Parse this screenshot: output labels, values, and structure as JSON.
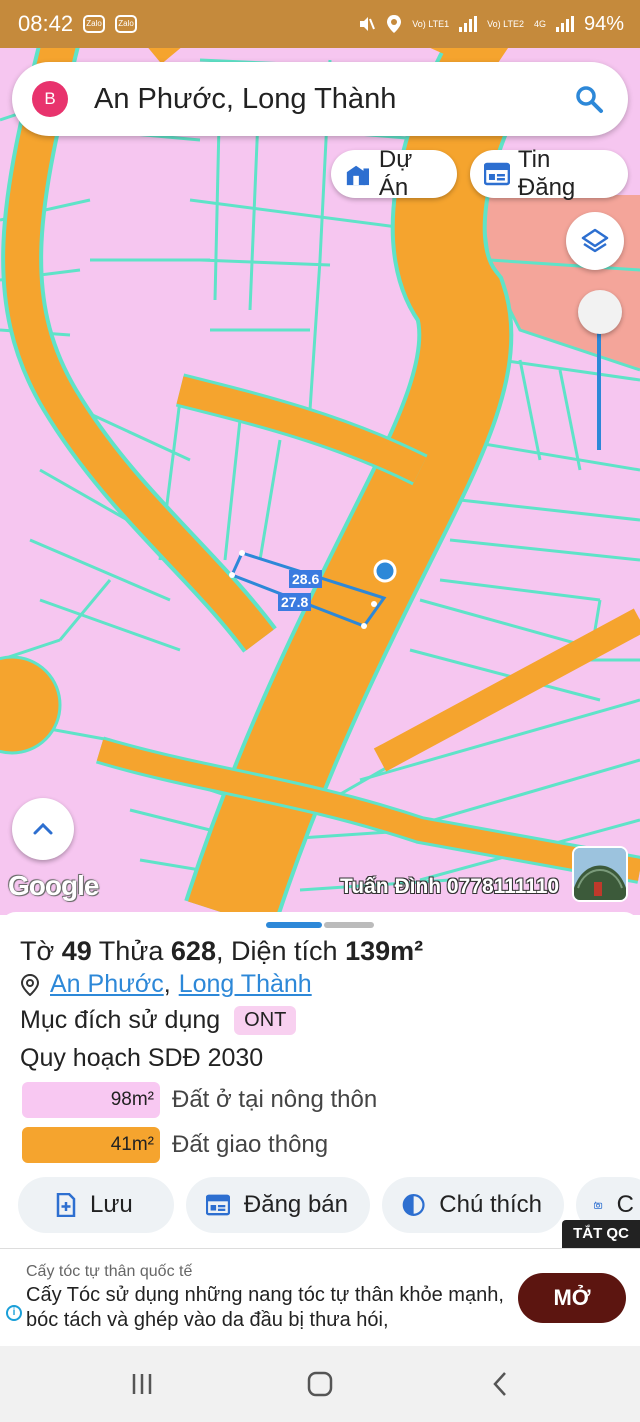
{
  "status_bar": {
    "time": "08:42",
    "app_icons": [
      "Zalo",
      "Zalo"
    ],
    "sim1": "Vo) LTE1",
    "sim2": "Vo) LTE2",
    "network": "4G",
    "battery": "94%"
  },
  "search": {
    "logo_letter": "B",
    "query": "An Phước, Long Thành"
  },
  "map_buttons": {
    "projects": "Dự Án",
    "listings": "Tin Đăng"
  },
  "map": {
    "dimension_top": "28.6",
    "dimension_bottom": "27.8",
    "google_logo": "Google",
    "watermark": "Tuấn Đình 0778111110",
    "colors": {
      "residential": "#f6c6f0",
      "road": "#f5a42e",
      "parcel_border": "#5fe3c8",
      "selection": "#2d88d8"
    }
  },
  "parcel": {
    "sheet_label": "Tờ",
    "sheet_no": "49",
    "plot_label": "Thửa",
    "plot_no": "628",
    "area_label": "Diện tích",
    "area": "139m²",
    "ward": "An Phước",
    "district": "Long Thành",
    "separator": ",",
    "purpose_label": "Mục đích sử dụng",
    "purpose_code": "ONT",
    "plan_title": "Quy hoạch SDĐ 2030",
    "zones": [
      {
        "area": "98m²",
        "name": "Đất ở tại nông thôn",
        "color": "#f8c8f2"
      },
      {
        "area": "41m²",
        "name": "Đất giao thông",
        "color": "#f5a42e"
      }
    ]
  },
  "actions": {
    "save": "Lưu",
    "post_sale": "Đăng bán",
    "legend": "Chú thích",
    "camera_partial": "C"
  },
  "ad": {
    "close_label": "TẮT QC",
    "sponsor": "Cấy tóc tự thân quốc tế",
    "text": "Cấy Tóc sử dụng những nang tóc tự thân khỏe mạnh, bóc tách và ghép vào da đầu bị thưa hói,",
    "cta": "MỞ"
  }
}
